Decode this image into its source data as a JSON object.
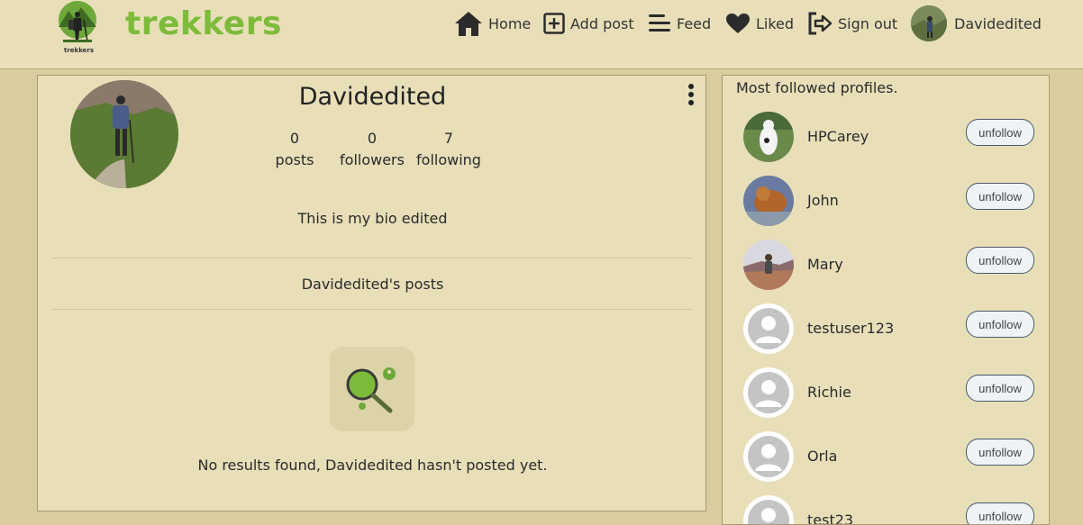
{
  "nav": {
    "brand": "trekkers",
    "logo_text": "trekkers",
    "items": [
      {
        "label": "Home",
        "icon": "home-icon"
      },
      {
        "label": "Add post",
        "icon": "plus-square-icon"
      },
      {
        "label": "Feed",
        "icon": "menu-lines-icon"
      },
      {
        "label": "Liked",
        "icon": "heart-icon"
      },
      {
        "label": "Sign out",
        "icon": "sign-out-icon"
      }
    ],
    "user_label": "Davidedited"
  },
  "profile": {
    "name": "Davidedited",
    "stats": [
      {
        "value": "0",
        "label": "posts"
      },
      {
        "value": "0",
        "label": "followers"
      },
      {
        "value": "7",
        "label": "following"
      }
    ],
    "bio": "This is my bio edited",
    "posts_title": "Davidedited's posts",
    "no_results": "No results found, Davidedited hasn't posted yet."
  },
  "most_followed": {
    "title": "Most followed profiles.",
    "button_label": "unfollow",
    "profiles": [
      {
        "name": "HPCarey",
        "avatar": "photo"
      },
      {
        "name": "John",
        "avatar": "photo"
      },
      {
        "name": "Mary",
        "avatar": "photo"
      },
      {
        "name": "testuser123",
        "avatar": "default"
      },
      {
        "name": "Richie",
        "avatar": "default"
      },
      {
        "name": "Orla",
        "avatar": "default"
      },
      {
        "name": "test23",
        "avatar": "default"
      }
    ]
  },
  "colors": {
    "background": "#d9cc9e",
    "card": "#e8dfb9",
    "brand_green": "#7dbb3b"
  }
}
